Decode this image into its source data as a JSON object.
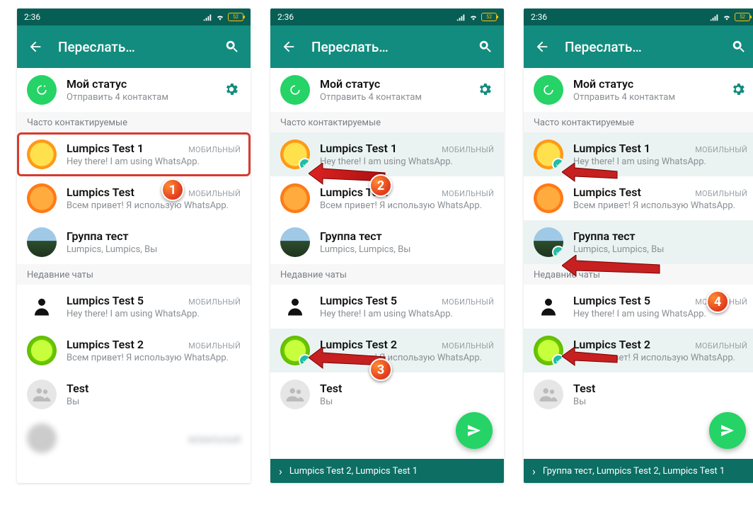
{
  "statusbar": {
    "time": "2:36",
    "battery": "52"
  },
  "header": {
    "title": "Переслать…"
  },
  "mystatus": {
    "title": "Мой статус",
    "sub": "Отправить 4 контактам"
  },
  "sections": {
    "frequent": "Часто контактируемые",
    "recent": "Недавние чаты"
  },
  "contacts": {
    "lt1": {
      "name": "Lumpics Test 1",
      "tag": "МОБИЛЬНЫЙ",
      "sub": "Hey there! I am using WhatsApp."
    },
    "lt": {
      "name": "Lumpics Test",
      "tag": "МОБИЛЬНЫЙ",
      "sub": "Всем привет! Я использую WhatsApp."
    },
    "grp": {
      "name": "Группа тест",
      "sub": "Lumpics, Lumpics, Вы"
    },
    "lt5": {
      "name": "Lumpics Test 5",
      "tag": "МОБИЛЬНЫЙ",
      "sub": "Hey there! I am using WhatsApp."
    },
    "lt2": {
      "name": "Lumpics Test 2",
      "tag": "МОБИЛЬНЫЙ",
      "sub": "Всем привет! Я использую WhatsApp."
    },
    "test": {
      "name": "Test",
      "sub": "Вы"
    },
    "blur": {
      "tag": "МОБИЛЬНЫЙ"
    }
  },
  "badges": {
    "b1": "1",
    "b2": "2",
    "b3": "3",
    "b4": "4"
  },
  "selbar": {
    "s2": "Lumpics Test 2, Lumpics Test 1",
    "s3": "Группа тест, Lumpics Test 2, Lumpics Test 1"
  }
}
